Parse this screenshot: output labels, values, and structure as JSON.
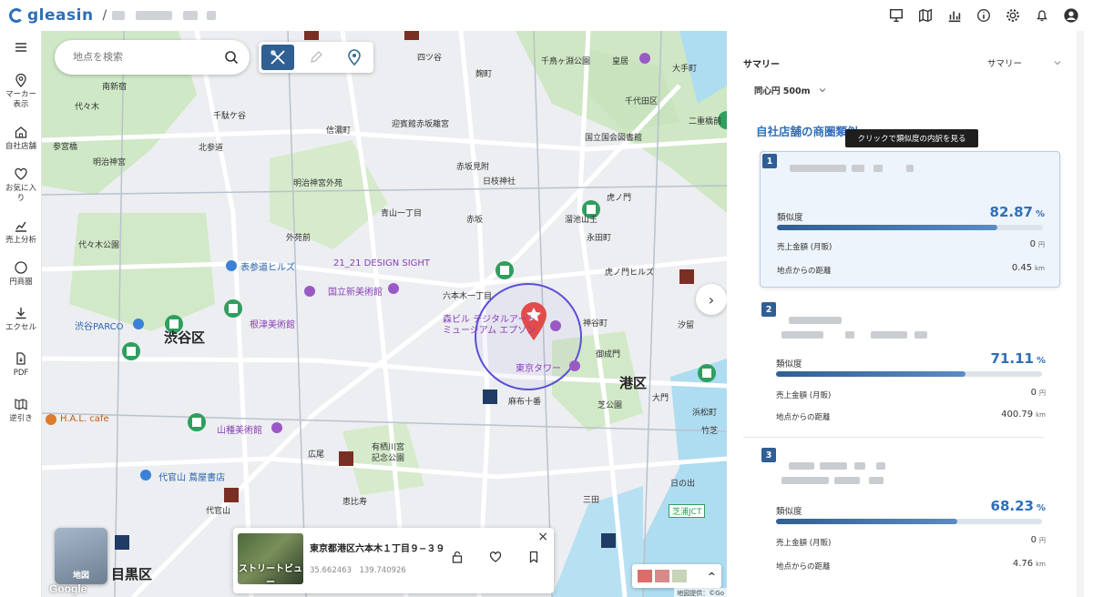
{
  "header": {
    "logo_text": "gleasin",
    "crumb_sep": "/",
    "icons": [
      "dashboard-icon",
      "map-icon",
      "chart-icon",
      "info-icon",
      "gear-icon",
      "bell-icon",
      "account-icon"
    ]
  },
  "sidebar": {
    "items": [
      {
        "id": "menu",
        "label": ""
      },
      {
        "id": "marker",
        "label": "マーカー\n表示"
      },
      {
        "id": "store",
        "label": "自社店舗"
      },
      {
        "id": "favorite",
        "label": "お気に入\nり"
      },
      {
        "id": "sales",
        "label": "売上分析"
      },
      {
        "id": "circle",
        "label": "円商圏"
      },
      {
        "id": "excel",
        "label": "エクセル"
      },
      {
        "id": "pdf",
        "label": "PDF"
      },
      {
        "id": "reverse",
        "label": "逆引き"
      }
    ]
  },
  "map": {
    "search_placeholder": "地点を検索",
    "labels": [
      {
        "text": "渋谷区",
        "cls": "big"
      },
      {
        "text": "港区",
        "cls": "big"
      },
      {
        "text": "目黒区",
        "cls": "big"
      },
      {
        "text": "国立新美術館",
        "cls": "purple"
      },
      {
        "text": "21_21 DESIGN SIGHT",
        "cls": "purple"
      },
      {
        "text": "東京タワー",
        "cls": "purple"
      },
      {
        "text": "森ビル デジタルアート\nミュージアム エプソン",
        "cls": "purple"
      },
      {
        "text": "根津美術館",
        "cls": "purple"
      },
      {
        "text": "山種美術館",
        "cls": "purple"
      },
      {
        "text": "表参道ヒルズ",
        "cls": "blue"
      },
      {
        "text": "渋谷PARCO",
        "cls": "blue"
      },
      {
        "text": "代官山 蔦屋書店",
        "cls": "blue"
      },
      {
        "text": "H.A.L. cafe",
        "cls": "orange"
      },
      {
        "text": "虎ノ門ヒルズ",
        "cls": ""
      },
      {
        "text": "明治神宮外苑",
        "cls": ""
      },
      {
        "text": "青山一丁目",
        "cls": ""
      },
      {
        "text": "六本木一丁目",
        "cls": ""
      },
      {
        "text": "麻布十番",
        "cls": ""
      },
      {
        "text": "国立国会図書館",
        "cls": ""
      },
      {
        "text": "千代田区",
        "cls": ""
      },
      {
        "text": "代々木公園",
        "cls": ""
      },
      {
        "text": "代々木",
        "cls": ""
      },
      {
        "text": "南新宿",
        "cls": ""
      },
      {
        "text": "参宮橋",
        "cls": ""
      },
      {
        "text": "明治神宮",
        "cls": ""
      },
      {
        "text": "北参道",
        "cls": ""
      },
      {
        "text": "千駄ケ谷",
        "cls": ""
      },
      {
        "text": "外苑前",
        "cls": ""
      },
      {
        "text": "赤坂",
        "cls": ""
      },
      {
        "text": "赤坂見附",
        "cls": ""
      },
      {
        "text": "溜池山王",
        "cls": ""
      },
      {
        "text": "日枝神社",
        "cls": ""
      },
      {
        "text": "虎ノ門",
        "cls": ""
      },
      {
        "text": "神谷町",
        "cls": ""
      },
      {
        "text": "御成門",
        "cls": ""
      },
      {
        "text": "汐留",
        "cls": ""
      },
      {
        "text": "浜松町",
        "cls": ""
      },
      {
        "text": "竹芝",
        "cls": ""
      },
      {
        "text": "日の出",
        "cls": ""
      },
      {
        "text": "三田",
        "cls": ""
      },
      {
        "text": "広尾",
        "cls": ""
      },
      {
        "text": "有栖川宮\n記念公園",
        "cls": ""
      },
      {
        "text": "恵比寿",
        "cls": ""
      },
      {
        "text": "代官山",
        "cls": ""
      },
      {
        "text": "芝浦JCT",
        "cls": ""
      },
      {
        "text": "四ツ谷",
        "cls": ""
      },
      {
        "text": "麹町",
        "cls": ""
      },
      {
        "text": "千鳥ヶ淵公園",
        "cls": ""
      },
      {
        "text": "皇居",
        "cls": ""
      },
      {
        "text": "大手町",
        "cls": ""
      },
      {
        "text": "二重橋前",
        "cls": ""
      },
      {
        "text": "永田町",
        "cls": ""
      },
      {
        "text": "迎賓館赤坂離宮",
        "cls": ""
      },
      {
        "text": "信濃町",
        "cls": ""
      },
      {
        "text": "芝公園",
        "cls": ""
      },
      {
        "text": "大門",
        "cls": ""
      }
    ],
    "street_view": {
      "label": "ストリートビュー",
      "address": "東京都港区六本木１丁目９−３９",
      "coords": "35.662463　139.740926",
      "close": "×"
    },
    "map_type_label": "地図",
    "google": "Google",
    "attribution": "地図提供：©Go",
    "expand": "›",
    "collapse": "^"
  },
  "panel": {
    "summary_title": "サマリー",
    "summary_dropdown": "サマリー",
    "radius_dropdown": "同心円 500m",
    "section_title": "自社店舗の商圏類似",
    "tooltip": "クリックで類似度の内訳を見る",
    "cards": [
      {
        "rank": "1",
        "similarity_label": "類似度",
        "similarity": "82.87",
        "pct": "%",
        "fill": 0.8287,
        "sales_label": "売上金額 (月販)",
        "sales": "0",
        "sales_unit": "円",
        "distance_label": "地点からの距離",
        "distance": "0.45",
        "distance_unit": "km"
      },
      {
        "rank": "2",
        "similarity_label": "類似度",
        "similarity": "71.11",
        "pct": "%",
        "fill": 0.7111,
        "sales_label": "売上金額 (月販)",
        "sales": "0",
        "sales_unit": "円",
        "distance_label": "地点からの距離",
        "distance": "400.79",
        "distance_unit": "km"
      },
      {
        "rank": "3",
        "similarity_label": "類似度",
        "similarity": "68.23",
        "pct": "%",
        "fill": 0.6823,
        "sales_label": "売上金額 (月販)",
        "sales": "0",
        "sales_unit": "円",
        "distance_label": "地点からの距離",
        "distance": "4.76",
        "distance_unit": "km"
      }
    ]
  },
  "colors": {
    "brand": "#2f6fb8",
    "accent_dark": "#2f5f93",
    "circle": "#5a4fd6",
    "pin": "#e24b4b"
  }
}
